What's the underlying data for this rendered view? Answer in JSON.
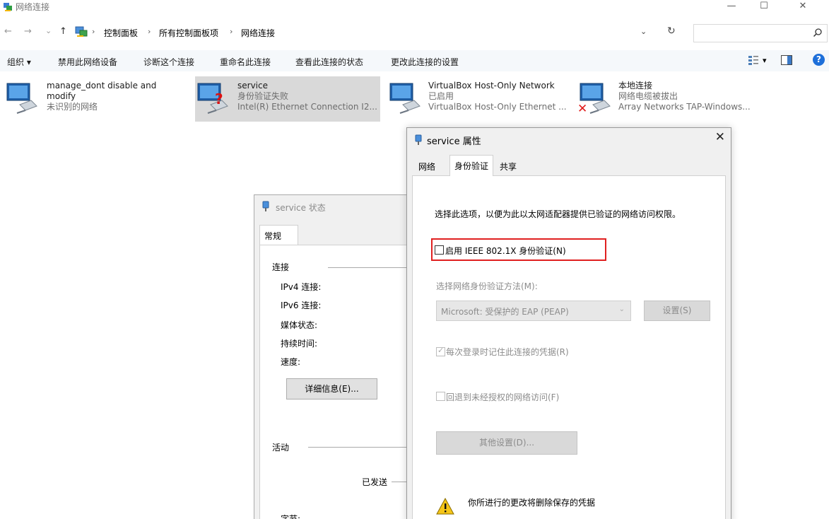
{
  "window": {
    "title": "网络连接",
    "controls": {
      "minimize": "—",
      "maximize": "☐",
      "close": "✕"
    }
  },
  "address": {
    "back": "←",
    "forward": "→",
    "recent": "⌄",
    "up": "↑",
    "separator": "›",
    "crumbs": [
      "控制面板",
      "所有控制面板项",
      "网络连接"
    ],
    "dropdown": "⌄",
    "refresh": "↻",
    "search_placeholder": "",
    "search_glyph": "⚲"
  },
  "toolbar": {
    "organize": "组织 ▾",
    "disable": "禁用此网络设备",
    "diagnose": "诊断这个连接",
    "rename": "重命名此连接",
    "view_status": "查看此连接的状态",
    "change_settings": "更改此连接的设置",
    "view_dropdown": "▾",
    "help": "?"
  },
  "connections": [
    {
      "name": "manage_dont disable and modify",
      "line1": "modify",
      "status": "未识别的网络",
      "adapter": "",
      "state": "normal"
    },
    {
      "name": "service",
      "status": "身份验证失败",
      "adapter": "Intel(R) Ethernet Connection I2...",
      "state": "question",
      "selected": true
    },
    {
      "name": "VirtualBox Host-Only Network",
      "status": "已启用",
      "adapter": "VirtualBox Host-Only Ethernet ...",
      "state": "normal"
    },
    {
      "name": "本地连接",
      "status": "网络电缆被拔出",
      "adapter": "Array Networks TAP-Windows...",
      "state": "disconnected"
    }
  ],
  "status_dialog": {
    "title": "service 状态",
    "tab": "常规",
    "connection_header": "连接",
    "ipv4": "IPv4 连接:",
    "ipv6": "IPv6 连接:",
    "media": "媒体状态:",
    "duration": "持续时间:",
    "speed": "速度:",
    "details_button": "详细信息(E)...",
    "activity_header": "活动",
    "sent": "已发送",
    "bytes": "字节:"
  },
  "properties_dialog": {
    "title": "service 属性",
    "close": "✕",
    "tabs": [
      "网络",
      "身份验证",
      "共享"
    ],
    "active_tab": "身份验证",
    "description": "选择此选项，以便为此以太网适配器提供已验证的网络访问权限。",
    "enable_8021x": {
      "label": "启用 IEEE 802.1X 身份验证(N)",
      "checked": false
    },
    "method_label": "选择网络身份验证方法(M):",
    "method_value": "Microsoft: 受保护的 EAP (PEAP)",
    "settings_button": "设置(S)",
    "remember_credentials": {
      "label": "每次登录时记住此连接的凭据(R)",
      "checked": true,
      "enabled": false
    },
    "fallback": {
      "label": "回退到未经授权的网络访问(F)",
      "checked": false,
      "enabled": false
    },
    "additional_settings_button": "其他设置(D)...",
    "warning": "你所进行的更改将删除保存的凭据"
  },
  "colors": {
    "highlight_border": "#e02020",
    "selected_bg": "#d9d9d9",
    "toolbar_bg": "#f5f8fb",
    "dialog_bg": "#f0f0f0",
    "disabled_text": "#8c8c8c",
    "help_blue": "#1e6fd9"
  }
}
